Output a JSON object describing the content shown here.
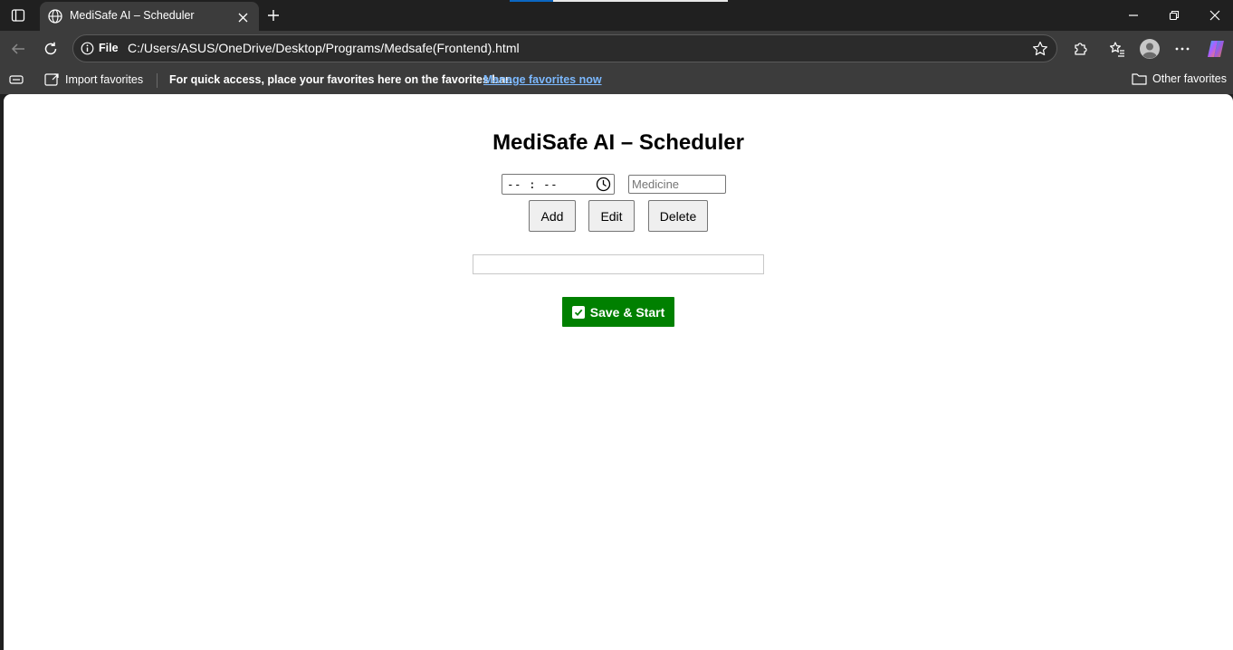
{
  "browser": {
    "tab": {
      "title": "MediSafe AI – Scheduler"
    },
    "address": {
      "scheme": "File",
      "url": "C:/Users/ASUS/OneDrive/Desktop/Programs/Medsafe(Frontend).html"
    },
    "favorites_bar": {
      "import_label": "Import favorites",
      "hint": "For quick access, place your favorites here on the favorites bar.",
      "manage_link": "Manage favorites now",
      "other_label": "Other favorites"
    },
    "accent_color": "#0b67c2"
  },
  "page": {
    "title": "MediSafe AI – Scheduler",
    "time_input": {
      "value": "-- : --"
    },
    "medicine_input": {
      "placeholder": "Medicine",
      "value": ""
    },
    "buttons": {
      "add": "Add",
      "edit": "Edit",
      "delete": "Delete"
    },
    "save_button": {
      "label": "Save & Start",
      "icon": "check-icon",
      "color": "#008000"
    }
  }
}
